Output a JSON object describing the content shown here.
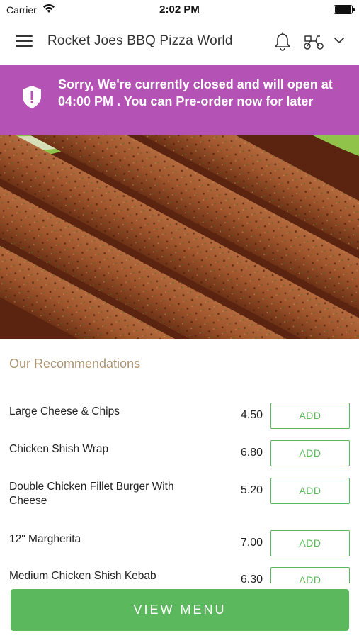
{
  "status_bar": {
    "carrier": "Carrier",
    "time": "2:02 PM"
  },
  "header": {
    "title": "Rocket Joes BBQ Pizza World",
    "icons": [
      "menu-icon",
      "bell-icon",
      "delivery-scooter-icon",
      "chevron-down-icon"
    ]
  },
  "banner": {
    "message": "Sorry, We're currently closed and will open at 04:00 PM . You can Pre-order now for later",
    "icon": "shield-alert-icon",
    "color": "#b552b5"
  },
  "hero": {
    "image": "seekh-kebabs-photo"
  },
  "recommendations": {
    "title": "Our Recommendations",
    "add_label": "ADD",
    "items": [
      {
        "name": "Large Cheese & Chips",
        "price": "4.50"
      },
      {
        "name": "Chicken Shish Wrap",
        "price": "6.80"
      },
      {
        "name": "Double Chicken Fillet Burger With Cheese",
        "price": "5.20"
      },
      {
        "name": "12\" Margherita",
        "price": "7.00"
      },
      {
        "name": "Medium Chicken Shish Kebab",
        "price": "6.30"
      }
    ]
  },
  "footer": {
    "view_menu_label": "VIEW MENU"
  },
  "colors": {
    "accent_green": "#5cb85c",
    "banner_purple": "#b552b5",
    "section_title": "#a99372"
  }
}
